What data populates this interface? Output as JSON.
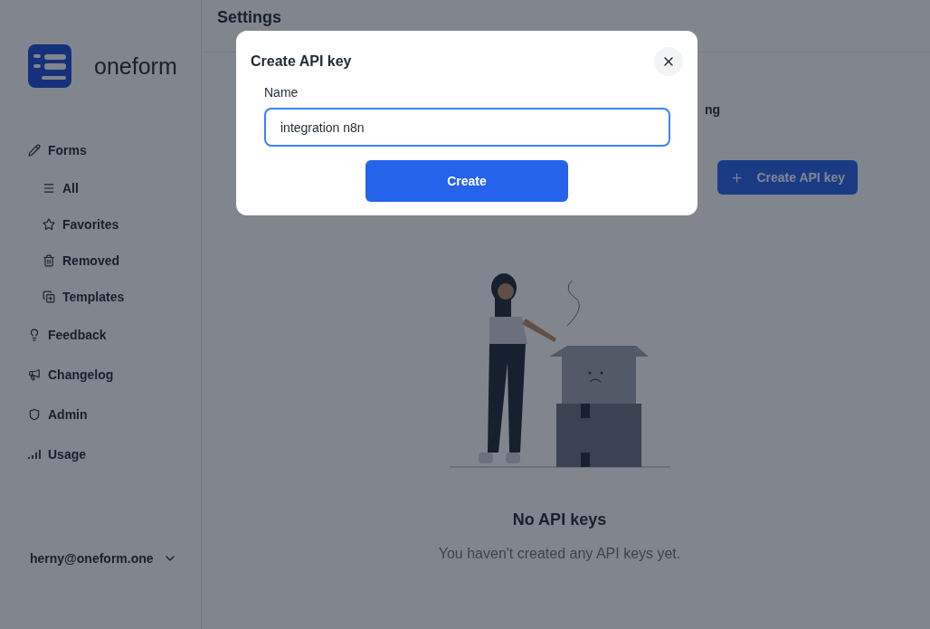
{
  "sidebar": {
    "logo_text": "oneform",
    "nav": [
      {
        "label": "Forms",
        "children": [
          {
            "label": "All"
          },
          {
            "label": "Favorites"
          },
          {
            "label": "Removed"
          },
          {
            "label": "Templates"
          }
        ]
      },
      {
        "label": "Feedback"
      },
      {
        "label": "Changelog"
      },
      {
        "label": "Admin"
      },
      {
        "label": "Usage"
      }
    ],
    "account": "herny@oneform.one"
  },
  "header": {
    "title": "Settings"
  },
  "main": {
    "partial_text": "ng",
    "create_button": "Create API key",
    "empty_title": "No API keys",
    "empty_text": "You haven't created any API keys yet."
  },
  "modal": {
    "title": "Create API key",
    "field_label": "Name",
    "field_value": "integration n8n",
    "submit": "Create"
  }
}
